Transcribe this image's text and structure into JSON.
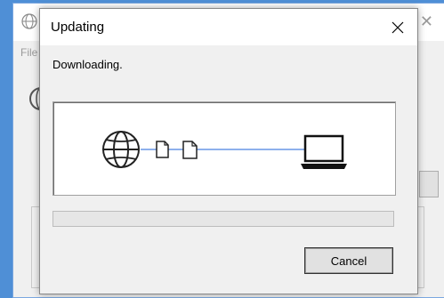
{
  "background_window": {
    "menu_label": "File",
    "close_glyph": "✕"
  },
  "dialog": {
    "title": "Updating",
    "close_glyph": "✕",
    "status_text": "Downloading.",
    "progress_value": 0,
    "cancel_label": "Cancel"
  },
  "icons": {
    "source": "globe-icon",
    "document": "document-icon",
    "target": "laptop-icon"
  },
  "colors": {
    "desktop": "#4f8fd6",
    "connector_line": "#4a80e0",
    "dialog_bg": "#f0f0f0"
  }
}
